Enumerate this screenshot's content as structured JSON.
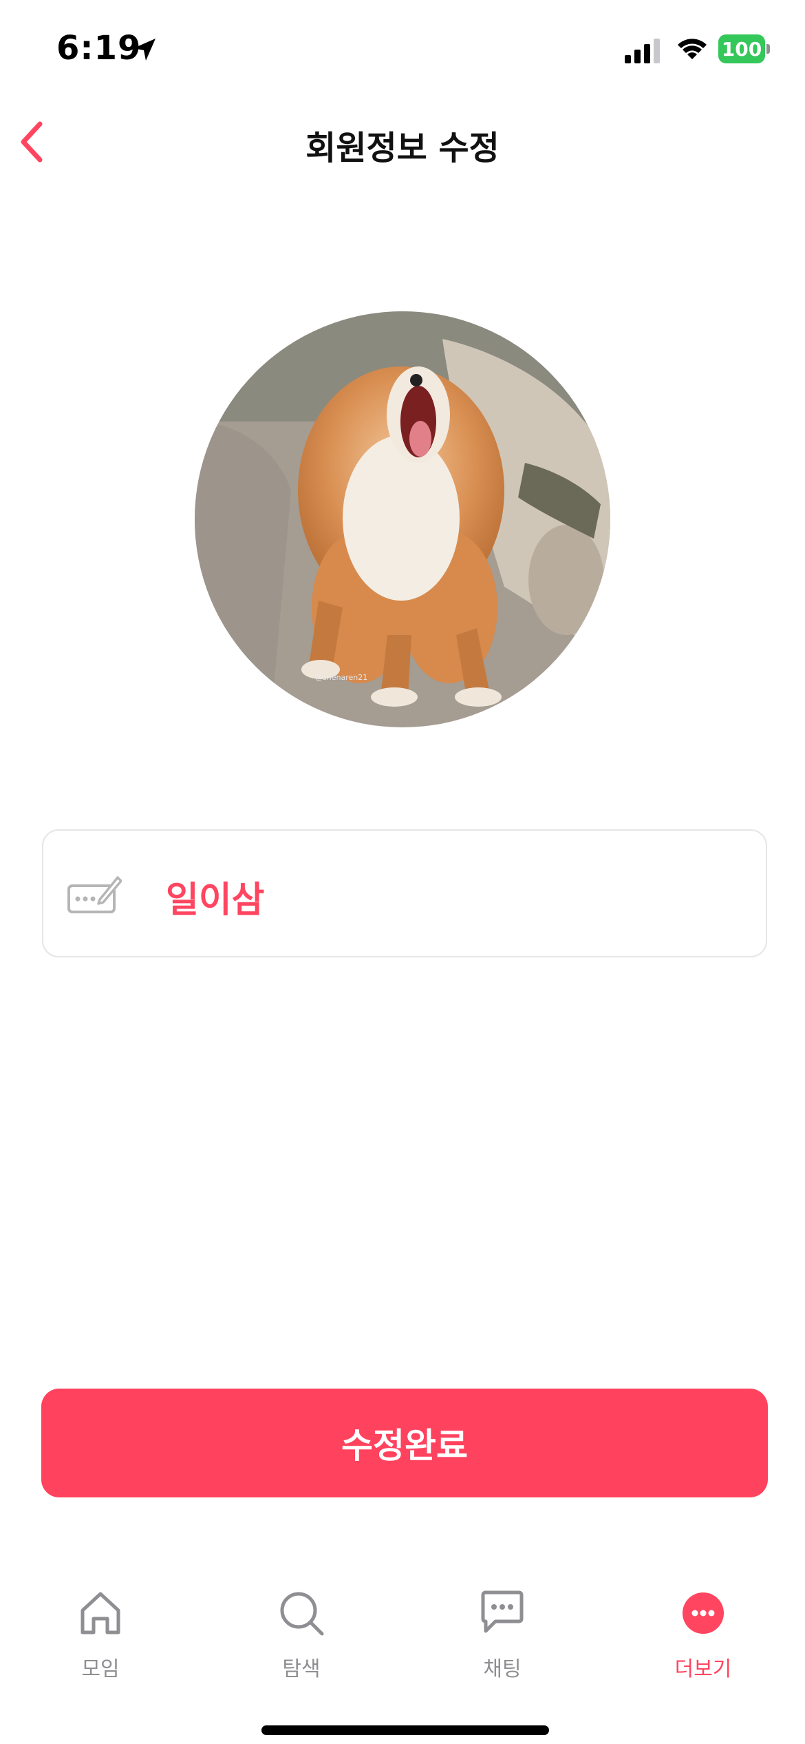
{
  "status_bar": {
    "time": "6:19",
    "battery": "100",
    "battery_color": "#34c759"
  },
  "header": {
    "title": "회원정보 수정",
    "back_icon": "chevron-left-icon"
  },
  "profile": {
    "avatar_icon": "profile-photo-fox"
  },
  "name_field": {
    "value": "일이삼",
    "icon": "edit-name-icon"
  },
  "actions": {
    "submit_label": "수정완료"
  },
  "tabbar": {
    "items": [
      {
        "label": "모임",
        "icon": "home-icon",
        "active": false
      },
      {
        "label": "탐색",
        "icon": "search-icon",
        "active": false
      },
      {
        "label": "채팅",
        "icon": "chat-bubble-icon",
        "active": false
      },
      {
        "label": "더보기",
        "icon": "more-icon",
        "active": true
      }
    ]
  },
  "colors": {
    "accent": "#ff425d",
    "inactive": "#8e8e93"
  }
}
